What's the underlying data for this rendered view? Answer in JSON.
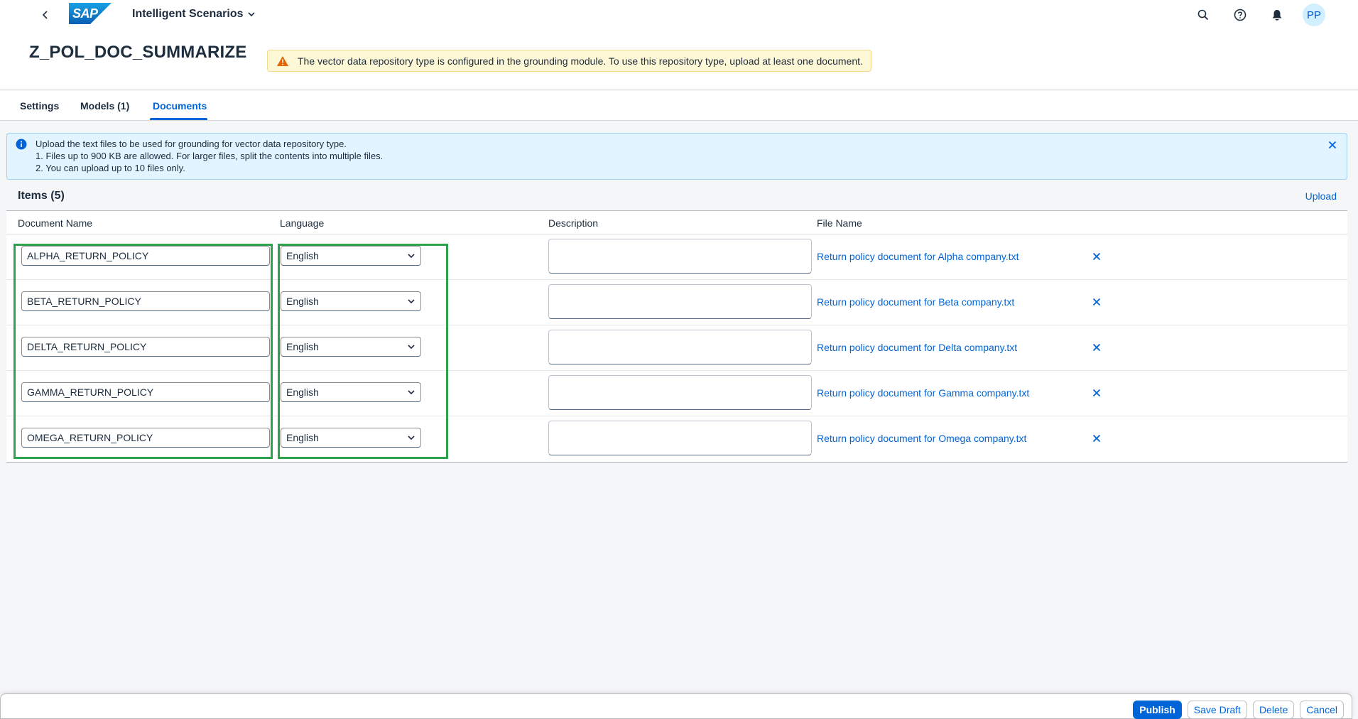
{
  "shell": {
    "logo_text": "SAP",
    "app_title": "Intelligent Scenarios",
    "avatar_initials": "PP",
    "brand_color": "#0a6ed1"
  },
  "header": {
    "title": "Z_POL_DOC_SUMMARIZE",
    "warning": "The vector data repository type is configured in the grounding module. To use this repository type, upload at least one document."
  },
  "tabs": [
    {
      "label": "Settings"
    },
    {
      "label": "Models (1)"
    },
    {
      "label": "Documents"
    }
  ],
  "active_tab": "Documents",
  "info": {
    "lines": [
      "Upload the text files to be used for grounding for vector data repository type.",
      "1. Files up to 900 KB are allowed. For larger files, split the contents into multiple files.",
      "2. You can upload up to 10 files only."
    ]
  },
  "table": {
    "title": "Items (5)",
    "upload_label": "Upload",
    "columns": [
      "Document Name",
      "Language",
      "Description",
      "File Name"
    ],
    "rows": [
      {
        "name": "ALPHA_RETURN_POLICY",
        "language": "English",
        "description": "",
        "file": "Return policy document for Alpha company.txt"
      },
      {
        "name": "BETA_RETURN_POLICY",
        "language": "English",
        "description": "",
        "file": "Return policy document for Beta company.txt"
      },
      {
        "name": "DELTA_RETURN_POLICY",
        "language": "English",
        "description": "",
        "file": "Return policy document for Delta company.txt"
      },
      {
        "name": "GAMMA_RETURN_POLICY",
        "language": "English",
        "description": "",
        "file": "Return policy document for Gamma company.txt"
      },
      {
        "name": "OMEGA_RETURN_POLICY",
        "language": "English",
        "description": "",
        "file": "Return policy document for Omega company.txt"
      }
    ]
  },
  "footer": {
    "publish": "Publish",
    "save_draft": "Save Draft",
    "delete": "Delete",
    "cancel": "Cancel"
  }
}
